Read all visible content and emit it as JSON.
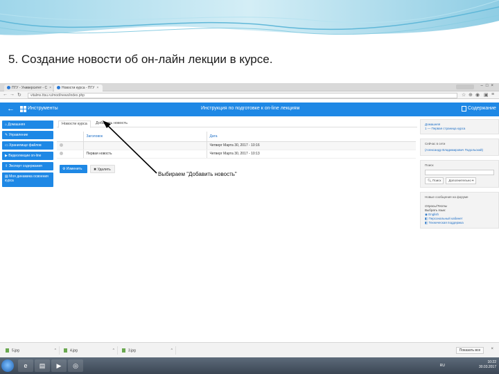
{
  "slide": {
    "title": "5. Создание новости об он-лайн лекции в курсе."
  },
  "browser": {
    "tabs": [
      {
        "label": "ПГУ - Университет - С",
        "close": "×"
      },
      {
        "label": "Новости курса - ПГУ",
        "close": "×"
      }
    ],
    "url": "vitalms.ttsu.ru/mod/news/index.php"
  },
  "topnav": {
    "back_icon": "←",
    "tools_label": "Инструменты",
    "course_title": "Инструкция по подготовке к on-line лекциям",
    "contents_label": "Содержание"
  },
  "sidebar": {
    "items": [
      {
        "label": "Домашняя",
        "icon": "home-icon"
      },
      {
        "label": "Управление",
        "icon": "wrench-icon"
      },
      {
        "label": "Хранилище файлов",
        "icon": "folder-icon"
      },
      {
        "label": "Видеолекции on-line",
        "icon": "video-icon"
      },
      {
        "label": "Экспорт содержания",
        "icon": "export-icon"
      },
      {
        "label": "Моя динамика освоения курса",
        "icon": "chart-icon"
      }
    ]
  },
  "content_tabs": [
    {
      "label": "Новости курса"
    },
    {
      "label": "Добавить новость"
    }
  ],
  "table": {
    "headers": [
      "Заголовок",
      "Дата"
    ],
    "rows": [
      {
        "title": "",
        "date": "Четверг Марта 30, 2017 - 10:16"
      },
      {
        "title": "Первая новость",
        "date": "Четверг Марта 30, 2017 - 10:13"
      }
    ]
  },
  "buttons": {
    "edit": "Изменить",
    "delete": "Удалить"
  },
  "callout": "Выбираем \"Добавить новость\"",
  "right_blocks": {
    "home": {
      "header": "Домашняя",
      "link": "1 — Первая страница курса"
    },
    "online": {
      "header": "Сейчас в сети",
      "user": "(Александр Владимирович Подольский)"
    },
    "search": {
      "header": "Поиск",
      "search_button": "Поиск",
      "more_button": "Дополнительно ▾"
    },
    "forum": {
      "header": "Новые сообщения на форуме",
      "sub1": "Опросы/Тесты",
      "sub2": "Выбрать язык:",
      "links": [
        "English",
        "Персональный кабинет",
        "Техническая поддержка"
      ]
    }
  },
  "downloads": {
    "items": [
      "5.jpg",
      "4.jpg",
      "3.jpg"
    ],
    "show_all": "Показать все",
    "close": "×"
  },
  "taskbar": {
    "lang": "RU",
    "time": "10:22",
    "date": "30.03.2017"
  }
}
